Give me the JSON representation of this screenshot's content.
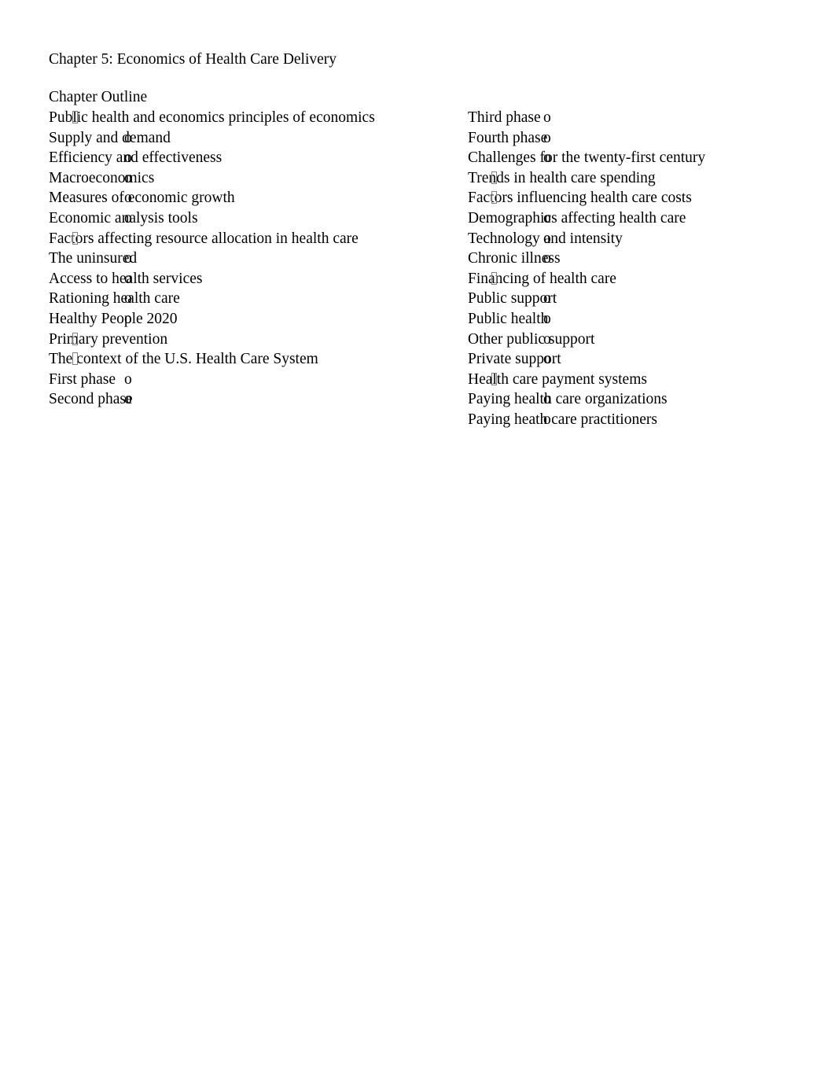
{
  "document": {
    "title": "Chapter 5: Economics of Health Care Delivery",
    "section_label": "Chapter Outline",
    "bullet_level1_glyph": "tofu-box",
    "bullet_level2_glyph": "o",
    "text_color": "#000000",
    "background_color": "#ffffff",
    "bullet_box_color": "#808080"
  },
  "outline": {
    "left_column": [
      {
        "level": 1,
        "text": "Public health and economics principles of economics"
      },
      {
        "level": 2,
        "text": "Supply and demand"
      },
      {
        "level": 2,
        "text": "Efficiency and effectiveness"
      },
      {
        "level": 2,
        "text": "Macroeconomics"
      },
      {
        "level": 2,
        "text": "Measures of economic growth"
      },
      {
        "level": 2,
        "text": "Economic analysis tools"
      },
      {
        "level": 1,
        "text": "Factors affecting resource allocation in health care"
      },
      {
        "level": 2,
        "text": "The uninsured"
      },
      {
        "level": 2,
        "text": "Access to health services"
      },
      {
        "level": 2,
        "text": "Rationing health care"
      },
      {
        "level": 2,
        "text": "Healthy People 2020"
      },
      {
        "level": 1,
        "text": "Primary prevention"
      },
      {
        "level": 1,
        "text": "The context of the U.S. Health Care System"
      },
      {
        "level": 2,
        "text": "First phase"
      },
      {
        "level": 2,
        "text": "Second phase"
      }
    ],
    "right_column": [
      {
        "level": 2,
        "text": "Third phase"
      },
      {
        "level": 2,
        "text": "Fourth phase"
      },
      {
        "level": 2,
        "text": "Challenges for the twenty-first century"
      },
      {
        "level": 1,
        "text": "Trends in health care spending"
      },
      {
        "level": 1,
        "text": "Factors influencing health care costs"
      },
      {
        "level": 2,
        "text": "Demographics affecting health care"
      },
      {
        "level": 2,
        "text": "Technology and intensity"
      },
      {
        "level": 2,
        "text": "Chronic illness"
      },
      {
        "level": 1,
        "text": "Financing of health care"
      },
      {
        "level": 2,
        "text": "Public support"
      },
      {
        "level": 2,
        "text": "Public health"
      },
      {
        "level": 2,
        "text": "Other public support"
      },
      {
        "level": 2,
        "text": "Private support"
      },
      {
        "level": 1,
        "text": "Health care payment systems"
      },
      {
        "level": 2,
        "text": "Paying health care organizations"
      },
      {
        "level": 2,
        "text": "Paying heath care practitioners"
      }
    ]
  }
}
